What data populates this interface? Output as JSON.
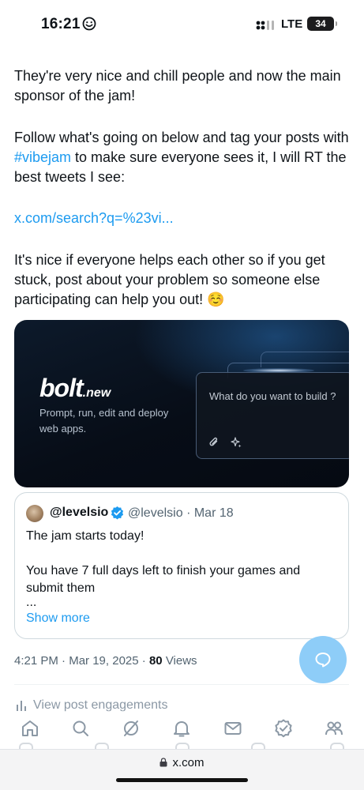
{
  "status": {
    "time": "16:21",
    "network": "LTE",
    "battery": "34"
  },
  "tweet": {
    "p1": "They're very nice and chill people and now the main sponsor of the jam!",
    "p2_before": "Follow what's going on below and tag your posts with ",
    "p2_hashtag": "#vibejam",
    "p2_after": " to make sure everyone sees it, I will RT the best tweets I see:",
    "link": "x.com/search?q=%23vi...",
    "p4": "It's nice if everyone helps each other so if you get stuck, post about your problem so someone else participating can help you out! ☺️"
  },
  "card": {
    "logo_main": "bolt",
    "logo_suffix": ".new",
    "tagline": "Prompt, run, edit and deploy web apps.",
    "input_placeholder": "What do you want to build ?"
  },
  "quote": {
    "name": "@levelsio",
    "handle": "@levelsio",
    "separator": "·",
    "date": "Mar 18",
    "line1": "The jam starts today!",
    "line2": "You have 7 full days left to finish your games and submit them",
    "ellipsis": "...",
    "show_more": "Show more"
  },
  "meta": {
    "time": "4:21 PM",
    "date": "Mar 19, 2025",
    "separator": "·",
    "views_count": "80",
    "views_label": "Views"
  },
  "engagements": "View post engagements",
  "nav": {
    "icons": [
      "home-icon",
      "search-icon",
      "grok-icon",
      "notifications-icon",
      "messages-icon",
      "verified-icon",
      "communities-icon"
    ]
  },
  "browser": {
    "url": "x.com"
  },
  "colors": {
    "accent": "#1d9bf0",
    "fab": "#8ecdf8",
    "text": "#0f1419",
    "muted": "#536471"
  }
}
